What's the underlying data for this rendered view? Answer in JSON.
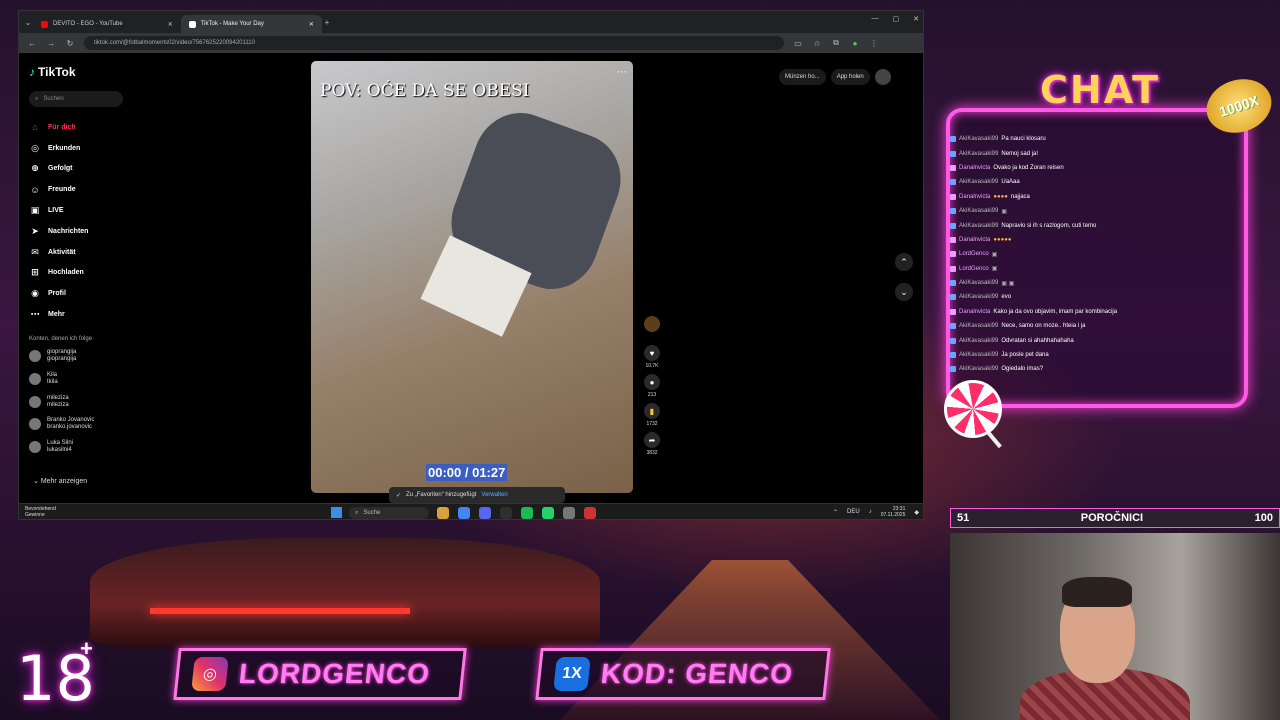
{
  "browser": {
    "tabs": [
      {
        "label": "DEVITO - EGO - YouTube",
        "color": "#ff0000",
        "active": false
      },
      {
        "label": "TikTok - Make Your Day",
        "color": "#ffffff",
        "active": true
      }
    ],
    "url": "tiktok.com/@fotbalmoments02/video/7567625220094201110"
  },
  "tiktok": {
    "logo": "TikTok",
    "search_placeholder": "Suchen",
    "nav": [
      {
        "icon": "home-icon",
        "label": "Für dich",
        "active": true
      },
      {
        "icon": "compass-icon",
        "label": "Erkunden"
      },
      {
        "icon": "following-icon",
        "label": "Gefolgt"
      },
      {
        "icon": "friends-icon",
        "label": "Freunde"
      },
      {
        "icon": "live-icon",
        "label": "LIVE"
      },
      {
        "icon": "messages-icon",
        "label": "Nachrichten"
      },
      {
        "icon": "activity-icon",
        "label": "Aktivität"
      },
      {
        "icon": "upload-icon",
        "label": "Hochladen"
      },
      {
        "icon": "profile-icon",
        "label": "Profil"
      },
      {
        "icon": "more-icon",
        "label": "Mehr"
      }
    ],
    "following_title": "Konten, denen ich folge",
    "following": [
      {
        "name": "gioprangija",
        "handle": "gioprangija"
      },
      {
        "name": "Kila",
        "handle": "tkila"
      },
      {
        "name": "mileziza",
        "handle": "mileziza"
      },
      {
        "name": "Branko Jovanovic",
        "handle": "branko.jovanovic"
      },
      {
        "name": "Luka Silni",
        "handle": "lukasilni4"
      }
    ],
    "more_accounts": "Mehr anzeigen",
    "video": {
      "caption": "POV: OĆE DA SE OBESI",
      "time": "00:00 / 01:27"
    },
    "actions": {
      "likes": "10.7K",
      "comments": "213",
      "saves": "1732",
      "shares": "3832"
    },
    "toast": {
      "text": "Zu „Favoriten“ hinzugefügt",
      "link": "Verwalten"
    },
    "top_right": {
      "coins": "Münzen ho...",
      "app": "App holen"
    }
  },
  "taskbar": {
    "weather_1": "Bevorstehend",
    "weather_2": "Gewinne",
    "search": "Suche",
    "lang": "DEU",
    "time": "23:31",
    "date": "07.11.2025"
  },
  "overlay": {
    "chat_title": "CHAT",
    "badge": "1000X",
    "chat": [
      {
        "user": "AkiKavasaki99",
        "text": "Pa nauci klosaru"
      },
      {
        "user": "AkiKavasaki99",
        "text": "Nemoj sad ja!"
      },
      {
        "user": "Danalnvicta",
        "text": "Ovako ja kod Zoran reisen",
        "alt": true
      },
      {
        "user": "AkiKavasaki99",
        "text": "UaAaa"
      },
      {
        "user": "Danalnvicta",
        "text": "najjaca",
        "alt": true
      },
      {
        "user": "AkiKavasaki99",
        "text": ""
      },
      {
        "user": "AkiKavasaki99",
        "text": "Napravio si ih s razlogom, cuti temo"
      },
      {
        "user": "Danalnvicta",
        "text": "",
        "alt": true
      },
      {
        "user": "LordGenco",
        "text": "",
        "alt": true
      },
      {
        "user": "LordGenco",
        "text": "",
        "alt": true
      },
      {
        "user": "AkiKavasaki99",
        "text": ""
      },
      {
        "user": "AkiKavasaki99",
        "text": "evo"
      },
      {
        "user": "Danalnvicta",
        "text": "Kako ja da ovo objavim, imam par kombinacija",
        "alt": true
      },
      {
        "user": "AkiKavasaki99",
        "text": "Nece, samo on moze.. hteia i ja"
      },
      {
        "user": "AkiKavasaki99",
        "text": "Odvratan si ahahhahahaha"
      },
      {
        "user": "AkiKavasaki99",
        "text": "Ja posle pet dana"
      },
      {
        "user": "AkiKavasaki99",
        "text": "Ogiedalo imas?"
      }
    ],
    "poll": {
      "left": "51",
      "title": "POROČNICI",
      "right": "100"
    },
    "age": "18",
    "age_plus": "+",
    "instagram": "LORDGENCO",
    "kod": "KOD: GENCO",
    "kod_logo": "1X"
  }
}
